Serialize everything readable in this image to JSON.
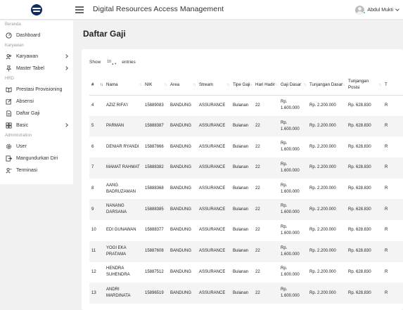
{
  "header": {
    "title": "Digital Resources Access Management",
    "user_name": "Abdul Mukti"
  },
  "sidebar": {
    "entries": [
      {
        "kind": "section",
        "label": "Beranda"
      },
      {
        "kind": "item",
        "label": "Dashboard",
        "icon": "dashboard-icon",
        "arrow": false
      },
      {
        "kind": "section",
        "label": "Karyawan"
      },
      {
        "kind": "item",
        "label": "Karyawan",
        "icon": "users-icon",
        "arrow": true
      },
      {
        "kind": "item",
        "label": "Master Tabel",
        "icon": "pin-icon",
        "arrow": true
      },
      {
        "kind": "section",
        "label": "HRD"
      },
      {
        "kind": "item",
        "label": "Prestasi Provisioning",
        "icon": "book-icon",
        "arrow": false
      },
      {
        "kind": "item",
        "label": "Absensi",
        "icon": "edit-icon",
        "arrow": false
      },
      {
        "kind": "item",
        "label": "Daftar Gaji",
        "icon": "document-icon",
        "arrow": false
      },
      {
        "kind": "item",
        "label": "Basic",
        "icon": "grid-icon",
        "arrow": true
      },
      {
        "kind": "section",
        "label": "Administration"
      },
      {
        "kind": "item",
        "label": "User",
        "icon": "settings-icon",
        "arrow": false
      },
      {
        "kind": "item",
        "label": "Mangundurkan Diri",
        "icon": "exit-icon",
        "arrow": false
      },
      {
        "kind": "item",
        "label": "Terminasi",
        "icon": "person-remove-icon",
        "arrow": false
      }
    ]
  },
  "page": {
    "title": "Daftar Gaji"
  },
  "table_controls": {
    "show_label": "Show",
    "entries_label": "entries",
    "page_length": "10"
  },
  "table": {
    "columns": [
      {
        "label": "#",
        "sorted": true
      },
      {
        "label": "Nama",
        "sorted": false
      },
      {
        "label": "NIK",
        "sorted": false
      },
      {
        "label": "Area",
        "sorted": false
      },
      {
        "label": "Stream",
        "sorted": false
      },
      {
        "label": "Tipe Gaji",
        "sorted": false
      },
      {
        "label": "Hari Hadir",
        "sorted": false
      },
      {
        "label": "Gaji Dasar",
        "sorted": false
      },
      {
        "label": "Tunjangan Dasar",
        "sorted": false
      },
      {
        "label": "Tunjangan Posisi",
        "sorted": false
      },
      {
        "label": "T",
        "sorted": false
      }
    ],
    "rows": [
      [
        "4",
        "AZIZ RIFA'I",
        "15889083",
        "BANDUNG",
        "ASSURANCE",
        "Bulanan",
        "22",
        "Rp. 1.600.000",
        "Rp. 2.200.000",
        "Rp. 628.830",
        "R"
      ],
      [
        "5",
        "PARMAN",
        "15888387",
        "BANDUNG",
        "ASSURANCE",
        "Bulanan",
        "22",
        "Rp. 1.600.000",
        "Rp. 2.200.000",
        "Rp. 628.830",
        "R"
      ],
      [
        "6",
        "DENIAR RYANDI",
        "15887866",
        "BANDUNG",
        "ASSURANCE",
        "Bulanan",
        "22",
        "Rp. 1.600.000",
        "Rp. 2.200.000",
        "Rp. 628.830",
        "R"
      ],
      [
        "7",
        "MAMAT RAHMAT",
        "15888382",
        "BANDUNG",
        "ASSURANCE",
        "Bulanan",
        "22",
        "Rp. 1.600.000",
        "Rp. 2.200.000",
        "Rp. 628.830",
        "R"
      ],
      [
        "8",
        "AANG BADRUZAMAN",
        "15888368",
        "BANDUNG",
        "ASSURANCE",
        "Bulanan",
        "22",
        "Rp. 1.600.000",
        "Rp. 2.200.000",
        "Rp. 628.830",
        "R"
      ],
      [
        "9",
        "NANANG DARSANA",
        "15888385",
        "BANDUNG",
        "ASSURANCE",
        "Bulanan",
        "22",
        "Rp. 1.600.000",
        "Rp. 2.200.000",
        "Rp. 628.830",
        "R"
      ],
      [
        "10",
        "EDI GUNAWAN",
        "15888377",
        "BANDUNG",
        "ASSURANCE",
        "Bulanan",
        "22",
        "Rp. 1.600.000",
        "Rp. 2.200.000",
        "Rp. 628.830",
        "R"
      ],
      [
        "11",
        "YOGI EKA PRATAMA",
        "15887608",
        "BANDUNG",
        "ASSURANCE",
        "Bulanan",
        "22",
        "Rp. 1.600.000",
        "Rp. 2.200.000",
        "Rp. 628.830",
        "R"
      ],
      [
        "12",
        "HENDRA SUHENDRA",
        "15887512",
        "BANDUNG",
        "ASSURANCE",
        "Bulanan",
        "22",
        "Rp. 1.600.000",
        "Rp. 2.200.000",
        "Rp. 628.830",
        "R"
      ],
      [
        "13",
        "ANDRI MARDINATA",
        "15896519",
        "BANDUNG",
        "ASSURANCE",
        "Bulanan",
        "22",
        "Rp. 1.600.000",
        "Rp. 2.200.000",
        "Rp. 628.830",
        "R"
      ]
    ]
  }
}
